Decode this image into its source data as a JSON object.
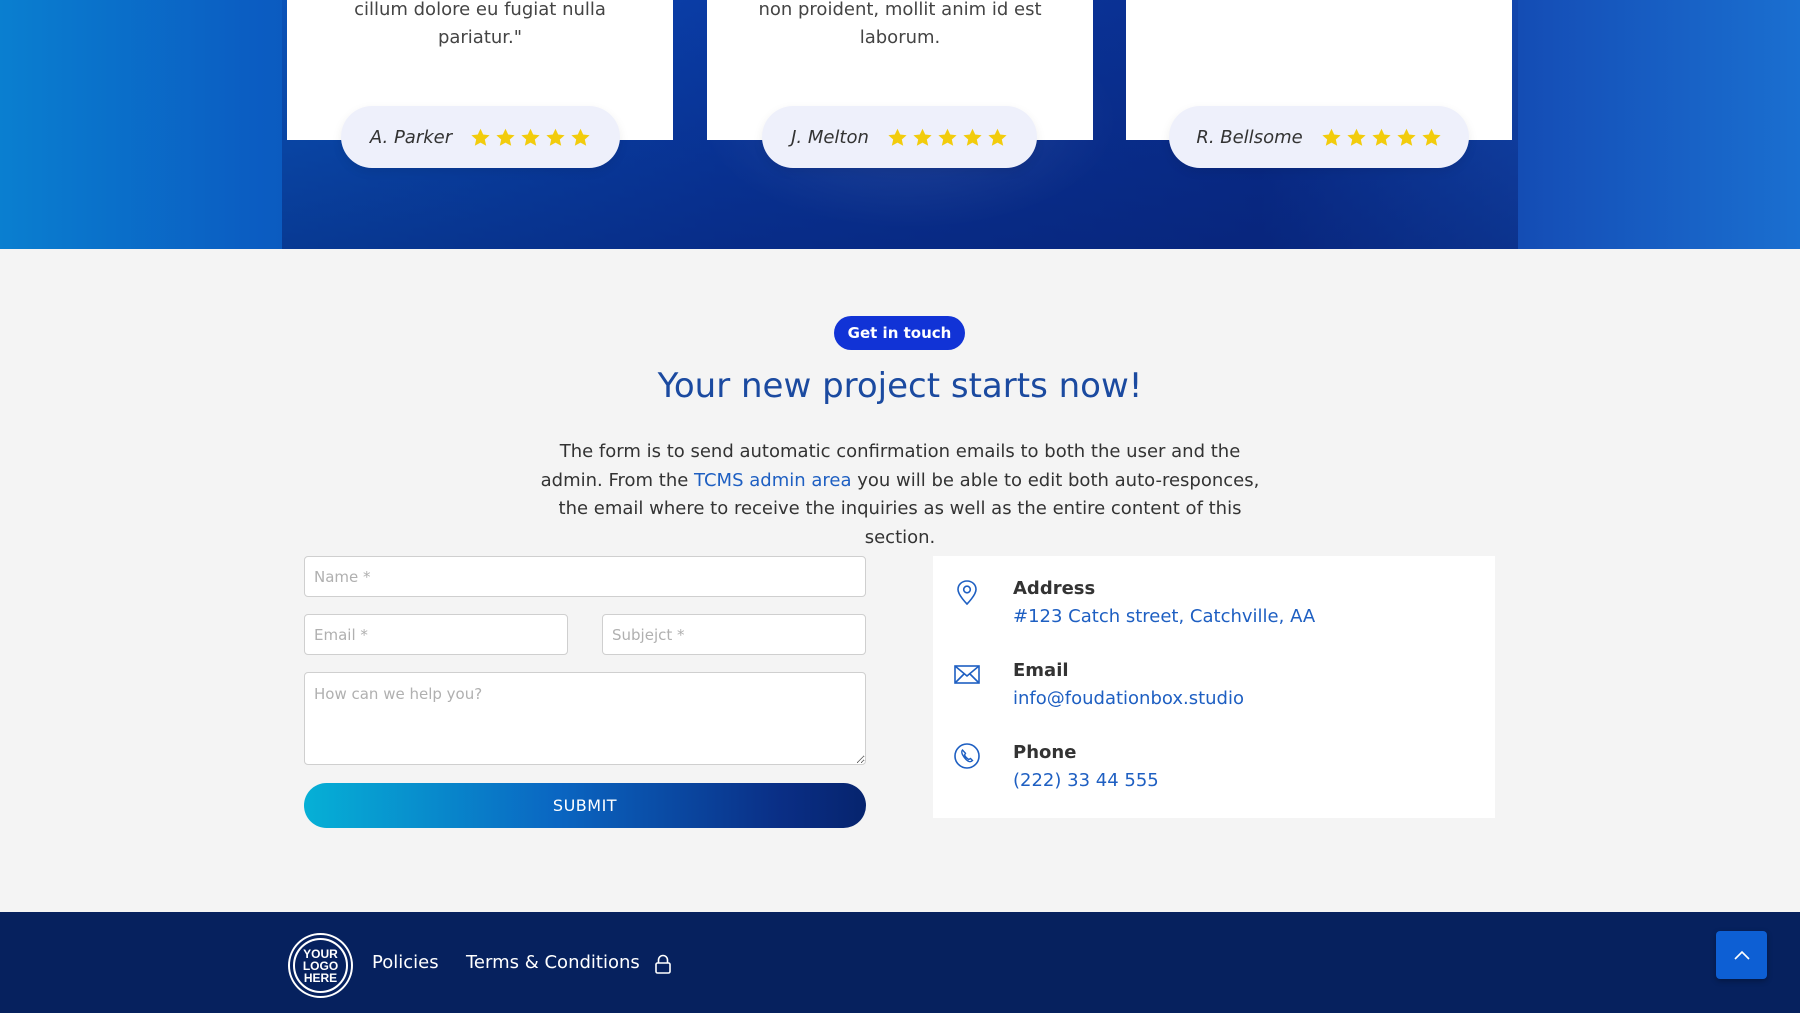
{
  "testimonials": [
    {
      "quote": "cillum dolore eu fugiat nulla pariatur.\"",
      "author": "A. Parker",
      "rating": 5
    },
    {
      "quote": "non proident, mollit anim id est laborum.",
      "author": "J. Melton",
      "rating": 5
    },
    {
      "quote": "",
      "author": "R. Bellsome",
      "rating": 5
    }
  ],
  "contact": {
    "badge": "Get in touch",
    "heading": "Your new project starts now!",
    "intro_part1": "The form is to send automatic confirmation emails to both the user and the admin. From the ",
    "intro_link": "TCMS admin area",
    "intro_part2": " you will be able to edit both auto-responces, the email where to receive the inquiries as well as the entire content of this section.",
    "form": {
      "name_placeholder": "Name *",
      "email_placeholder": "Email *",
      "subject_placeholder": "Subjejct *",
      "message_placeholder": "How can we help you?",
      "submit_label": "SUBMIT"
    },
    "info": {
      "address_label": "Address",
      "address_value": "#123 Catch street, Catchville, AA",
      "email_label": "Email",
      "email_value": "info@foudationbox.studio",
      "phone_label": "Phone",
      "phone_value": "(222) 33 44 555"
    }
  },
  "footer": {
    "logo_text": "YOUR LOGO HERE",
    "links": [
      "Policies",
      "Terms & Conditions"
    ]
  },
  "colors": {
    "accent": "#1133d6",
    "link": "#1e5fc2",
    "heading": "#1b4aa0",
    "footer_bg": "#06215e",
    "star": "#f2cc0c"
  },
  "icons": [
    "star-icon",
    "map-pin-icon",
    "envelope-icon",
    "phone-icon",
    "lock-icon",
    "chevron-up-icon"
  ]
}
